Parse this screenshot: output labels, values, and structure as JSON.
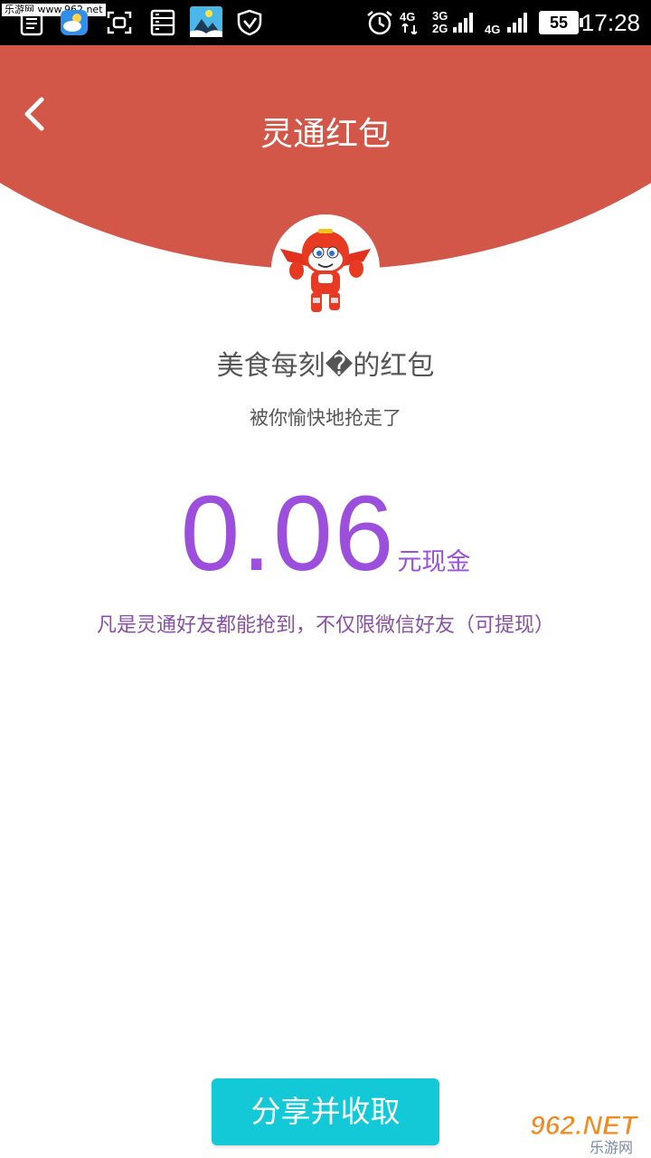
{
  "status_bar": {
    "watermark": "乐游网 www.962.net",
    "network_1": "4G",
    "network_2": "3G",
    "network_3": "2G",
    "network_4": "4G",
    "battery": "55",
    "time": "17:28"
  },
  "header": {
    "title": "灵通红包",
    "background_color": "#d35749"
  },
  "packet": {
    "sender_line": "美食每刻�的红包",
    "status_line": "被你愉快地抢走了",
    "amount": "0.06",
    "unit": "元现金",
    "note": "凡是灵通好友都能抢到，不仅限微信好友（可提现）",
    "accent_color": "#9b4fdc"
  },
  "actions": {
    "share_label": "分享并收取",
    "button_color": "#13c9d8"
  },
  "watermark_logo": {
    "brand": "962.NET",
    "sub": "乐游网"
  },
  "icons": [
    "notes-icon",
    "weather-icon",
    "scan-icon",
    "storage-icon",
    "mountain-app-icon",
    "shield-icon",
    "alarm-icon",
    "signal-icon",
    "back-icon",
    "avatar-image"
  ]
}
